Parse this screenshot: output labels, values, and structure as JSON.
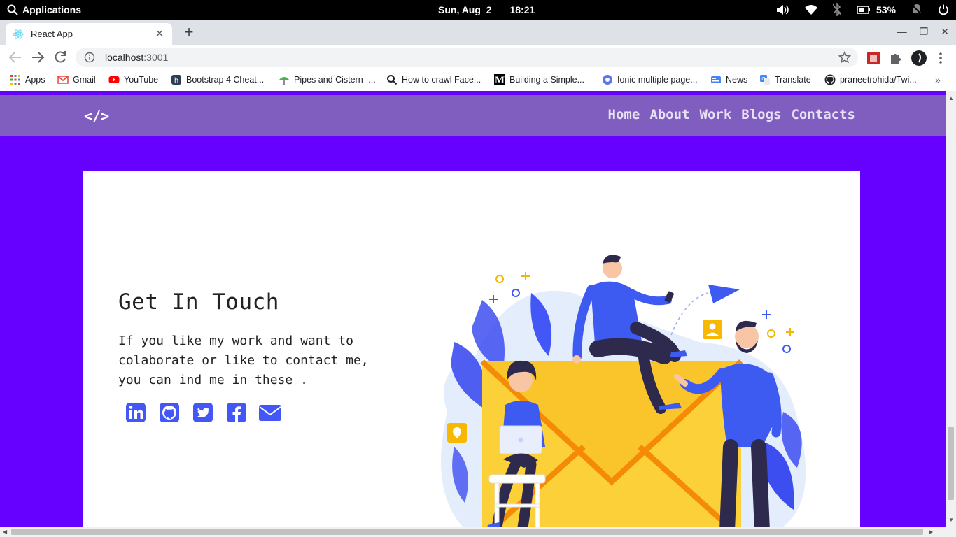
{
  "os": {
    "apps_label": "Applications",
    "date": "Sun, Aug  2",
    "time": "18:21",
    "battery": "53%"
  },
  "browser": {
    "tab_title": "React App",
    "url_host": "localhost",
    "url_port": ":3001",
    "bookmarks": [
      {
        "label": "Apps"
      },
      {
        "label": "Gmail"
      },
      {
        "label": "YouTube"
      },
      {
        "label": "Bootstrap 4 Cheat..."
      },
      {
        "label": "Pipes and Cistern -..."
      },
      {
        "label": "How to crawl Face..."
      },
      {
        "label": "Building a Simple..."
      },
      {
        "label": "Ionic multiple page..."
      },
      {
        "label": "News"
      },
      {
        "label": "Translate"
      },
      {
        "label": "praneetrohida/Twi..."
      }
    ]
  },
  "site": {
    "logo": "</>",
    "nav": [
      "Home",
      "About",
      "Work",
      "Blogs",
      "Contacts"
    ],
    "contact": {
      "heading": "Get In Touch",
      "description": "If you like my work and want to colaborate or like to contact me, you can ind me in these ."
    },
    "socials": [
      "linkedin-icon",
      "github-icon",
      "twitter-icon",
      "facebook-icon",
      "email-icon"
    ]
  },
  "colors": {
    "page_bg": "#6600ff",
    "navbar_bg": "#7f5ebf",
    "accent_blue": "#4257f5",
    "envelope_yellow": "#fbd038",
    "envelope_orange": "#f5a623"
  }
}
